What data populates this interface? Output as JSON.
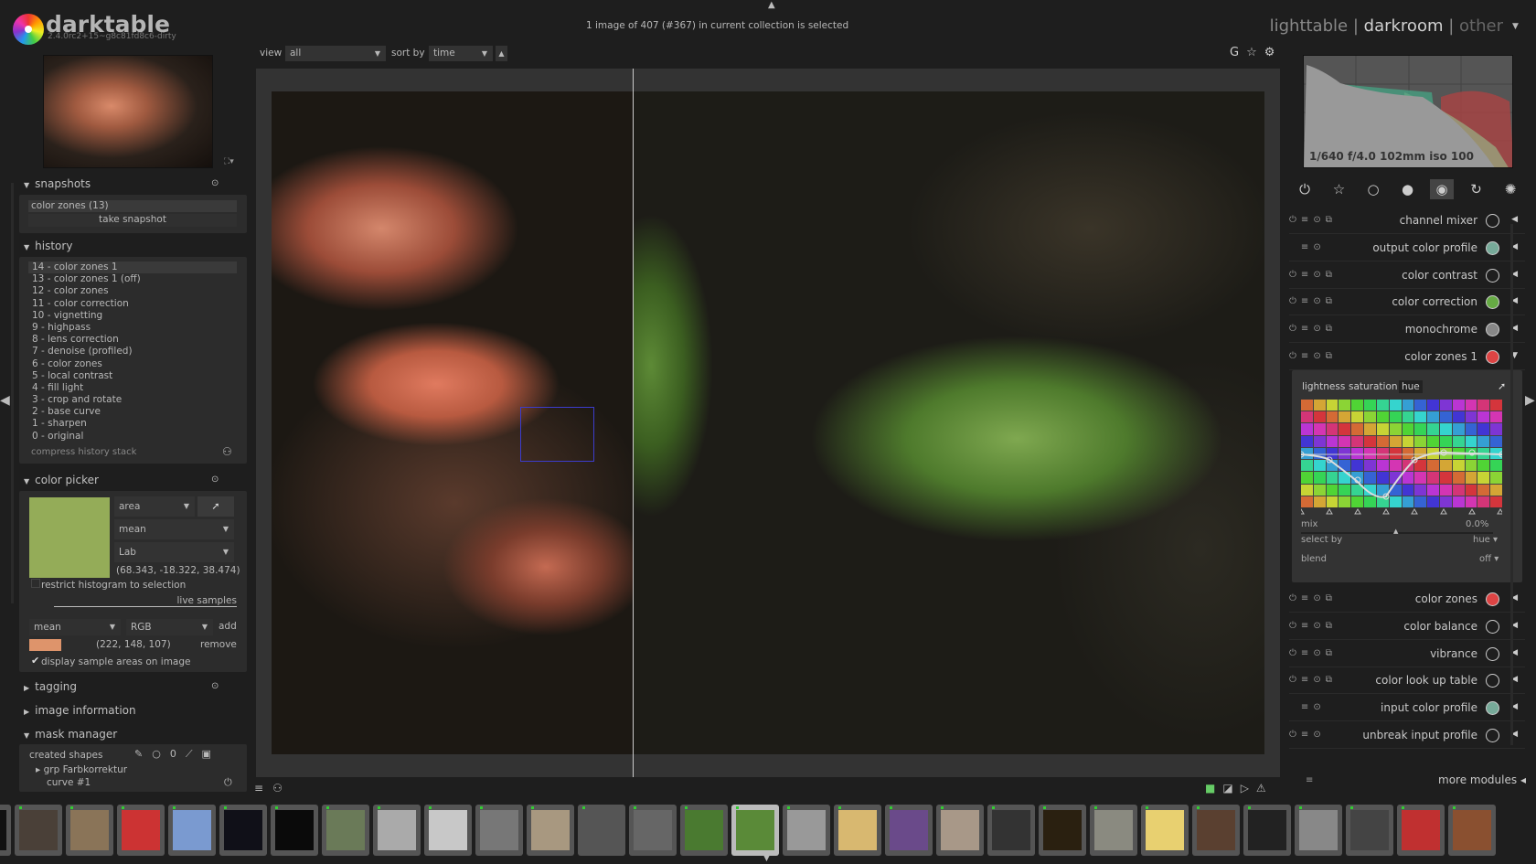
{
  "app": {
    "title": "darktable",
    "version": "2.4.0rc2+15~g8c81fd8c6-dirty"
  },
  "header": {
    "status": "1 image of 407 (#367) in current collection is selected",
    "view_label": "view",
    "view_value": "all",
    "sort_label": "sort by",
    "sort_value": "time",
    "modes": [
      "lighttable",
      "darkroom",
      "other"
    ],
    "active_mode": "darkroom",
    "sep": "|"
  },
  "snapshots": {
    "title": "snapshots",
    "items": [
      "color zones (13)"
    ],
    "take_label": "take snapshot"
  },
  "history": {
    "title": "history",
    "items": [
      "14 - color zones 1",
      "13 - color zones 1 (off)",
      "12 - color zones",
      "11 - color correction",
      "10 - vignetting",
      "9 - highpass",
      "8 - lens correction",
      "7 - denoise (profiled)",
      "6 - color zones",
      "5 - local contrast",
      "4 - fill light",
      "3 - crop and rotate",
      "2 - base curve",
      "1 - sharpen",
      "0 - original"
    ],
    "compress_label": "compress history stack"
  },
  "color_picker": {
    "title": "color picker",
    "swatch_color": "#94ac58",
    "mode": "area",
    "stat": "mean",
    "space": "Lab",
    "values": "(68.343, -18.322, 38.474)",
    "restrict_label": "restrict histogram to selection",
    "restrict_checked": false,
    "live_label": "live samples",
    "live_stat": "mean",
    "live_space": "RGB",
    "add_label": "add",
    "sample_color": "#de946b",
    "sample_values": "(222, 148, 107)",
    "remove_label": "remove",
    "display_label": "display sample areas on image",
    "display_checked": true
  },
  "collapsed_panels": [
    "tagging",
    "image information"
  ],
  "mask_manager": {
    "title": "mask manager",
    "created_label": "created shapes",
    "group": "grp Farbkorrektur",
    "shape": "curve #1"
  },
  "histogram": {
    "exif": "1/640 f/4.0 102mm iso 100"
  },
  "module_groups": [
    {
      "icon": "power-icon",
      "glyph": "⏻"
    },
    {
      "icon": "star-icon",
      "glyph": "☆"
    },
    {
      "icon": "circle-icon",
      "glyph": "○"
    },
    {
      "icon": "tone-icon",
      "glyph": "●"
    },
    {
      "icon": "color-icon",
      "glyph": "◉",
      "active": true
    },
    {
      "icon": "correct-icon",
      "glyph": "↻"
    },
    {
      "icon": "effect-icon",
      "glyph": "✺"
    }
  ],
  "modules": [
    {
      "name": "channel mixer",
      "icon": "channel-mixer-icon",
      "enable": true,
      "instance": true
    },
    {
      "name": "output color profile",
      "icon": "output-profile-icon",
      "color": "#7a9",
      "enable": false,
      "instance": false
    },
    {
      "name": "color contrast",
      "icon": "color-contrast-icon",
      "enable": true,
      "instance": true
    },
    {
      "name": "color correction",
      "icon": "color-correction-icon",
      "color": "#6a4",
      "enable": true,
      "instance": true
    },
    {
      "name": "monochrome",
      "icon": "monochrome-icon",
      "color": "#888",
      "enable": true,
      "instance": true
    },
    {
      "name": "color zones 1",
      "icon": "color-zones-icon",
      "color": "#d44",
      "enable": true,
      "instance": true,
      "expanded": true
    }
  ],
  "modules_after": [
    {
      "name": "color zones",
      "icon": "color-zones-icon",
      "color": "#d44",
      "enable": true,
      "instance": true
    },
    {
      "name": "color balance",
      "icon": "color-balance-icon",
      "enable": true,
      "instance": true
    },
    {
      "name": "vibrance",
      "icon": "vibrance-icon",
      "enable": true,
      "instance": true
    },
    {
      "name": "color look up table",
      "icon": "lut-icon",
      "enable": true,
      "instance": true
    },
    {
      "name": "input color profile",
      "icon": "input-profile-icon",
      "color": "#7a9",
      "enable": false,
      "instance": false
    },
    {
      "name": "unbreak input profile",
      "icon": "unbreak-icon",
      "enable": true,
      "instance": false
    }
  ],
  "color_zones": {
    "tabs": [
      "lightness",
      "saturation",
      "hue"
    ],
    "active_tab": "hue",
    "mix_label": "mix",
    "mix_value": "0.0%",
    "mix_fraction": 0.5,
    "select_label": "select by",
    "select_value": "hue",
    "blend_label": "blend",
    "blend_value": "off"
  },
  "more_modules": "more modules",
  "filmstrip": {
    "thumbs": [
      "#111",
      "#4a4038",
      "#8a7458",
      "#c33",
      "#7a9ad0",
      "#101018",
      "#0a0a0a",
      "#6a7a58",
      "#aaa",
      "#c8c8c8",
      "#777",
      "#a89880",
      "#555",
      "#666",
      "#4a7a30",
      "#5a8a38",
      "#999",
      "#d8b870",
      "#6a4a8a",
      "#a89888",
      "#333",
      "#2a2010",
      "#8a8a80",
      "#e8d070",
      "#5a4030",
      "#222",
      "#888",
      "#444",
      "#c03030",
      "#8a5030"
    ],
    "selected": 15
  }
}
